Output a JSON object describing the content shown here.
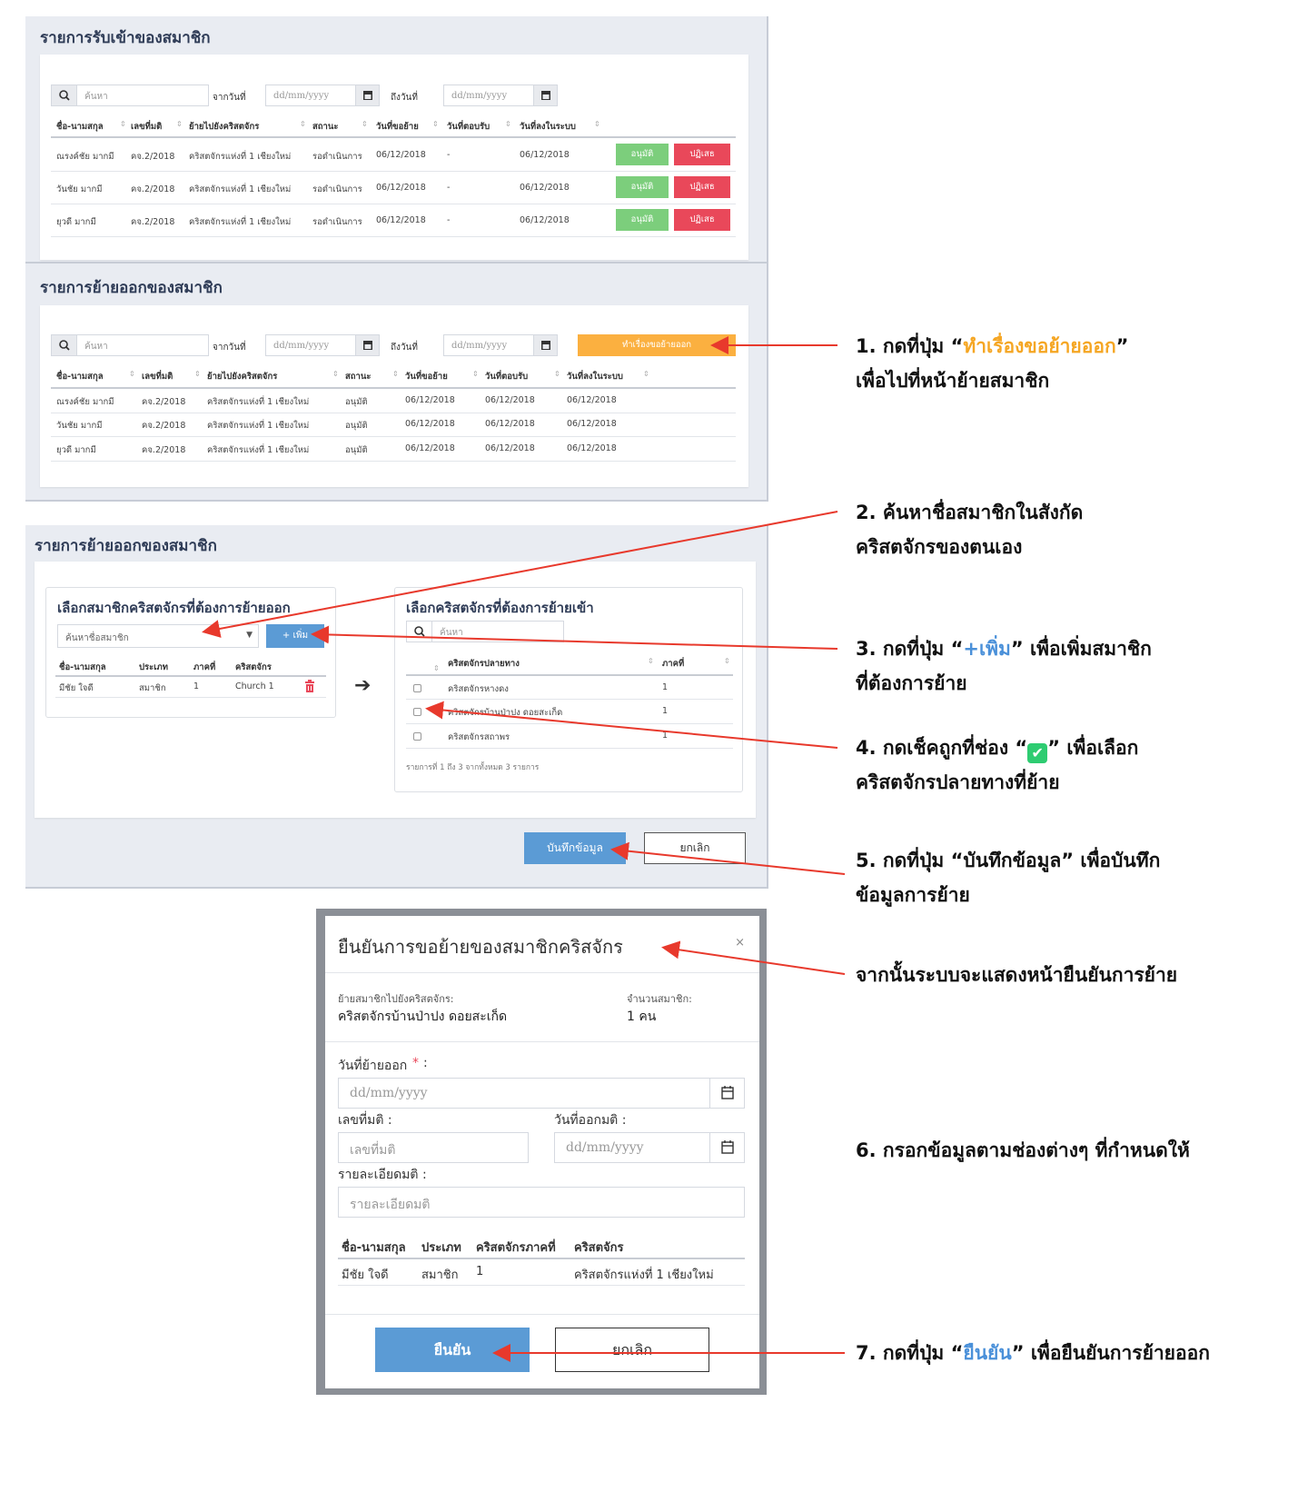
{
  "section1": {
    "title": "รายการรับเข้าของสมาชิก",
    "search_placeholder": "ค้นหา",
    "from_label": "จากวันที่",
    "to_label": "ถึงวันที่",
    "date_placeholder": "dd/mm/yyyy",
    "columns": [
      "ชื่อ-นามสกุล",
      "เลขที่มติ",
      "ย้ายไปยังคริสตจักร",
      "สถานะ",
      "วันที่ขอย้าย",
      "วันที่ตอบรับ",
      "วันที่ลงในระบบ"
    ],
    "rows": [
      {
        "name": "ณรงค์ชัย มากมี",
        "no": "คจ.2/2018",
        "church": "คริสตจักรแห่งที่ 1 เชียงใหม่",
        "status": "รอดำเนินการ",
        "req": "06/12/2018",
        "acc": "-",
        "sys": "06/12/2018"
      },
      {
        "name": "วันชัย มากมี",
        "no": "คจ.2/2018",
        "church": "คริสตจักรแห่งที่ 1 เชียงใหม่",
        "status": "รอดำเนินการ",
        "req": "06/12/2018",
        "acc": "-",
        "sys": "06/12/2018"
      },
      {
        "name": "ยุวดี มากมี",
        "no": "คจ.2/2018",
        "church": "คริสตจักรแห่งที่ 1 เชียงใหม่",
        "status": "รอดำเนินการ",
        "req": "06/12/2018",
        "acc": "-",
        "sys": "06/12/2018"
      }
    ],
    "approve_label": "อนุมัติ",
    "reject_label": "ปฏิเสธ"
  },
  "section2": {
    "title": "รายการย้ายออกของสมาชิก",
    "search_placeholder": "ค้นหา",
    "from_label": "จากวันที่",
    "to_label": "ถึงวันที่",
    "date_placeholder": "dd/mm/yyyy",
    "action_label": "ทำเรื่องขอย้ายออก",
    "columns": [
      "ชื่อ-นามสกุล",
      "เลขที่มติ",
      "ย้ายไปยังคริสตจักร",
      "สถานะ",
      "วันที่ขอย้าย",
      "วันที่ตอบรับ",
      "วันที่ลงในระบบ"
    ],
    "rows": [
      {
        "name": "ณรงค์ชัย มากมี",
        "no": "คจ.2/2018",
        "church": "คริสตจักรแห่งที่ 1 เชียงใหม่",
        "status": "อนุมัติ",
        "req": "06/12/2018",
        "acc": "06/12/2018",
        "sys": "06/12/2018"
      },
      {
        "name": "วันชัย มากมี",
        "no": "คจ.2/2018",
        "church": "คริสตจักรแห่งที่ 1 เชียงใหม่",
        "status": "อนุมัติ",
        "req": "06/12/2018",
        "acc": "06/12/2018",
        "sys": "06/12/2018"
      },
      {
        "name": "ยุวดี มากมี",
        "no": "คจ.2/2018",
        "church": "คริสตจักรแห่งที่ 1 เชียงใหม่",
        "status": "อนุมัติ",
        "req": "06/12/2018",
        "acc": "06/12/2018",
        "sys": "06/12/2018"
      }
    ]
  },
  "section3": {
    "title": "รายการย้ายออกของสมาชิก",
    "left": {
      "title": "เลือกสมาชิกคริสตจักรที่ต้องการย้ายออก",
      "select_placeholder": "ค้นหาชื่อสมาชิก",
      "add_label": "+ เพิ่ม",
      "columns": [
        "ชื่อ-นามสกุล",
        "ประเภท",
        "ภาคที่",
        "คริสตจักร"
      ],
      "row": {
        "name": "มีชัย ใจดี",
        "type": "สมาชิก",
        "region": "1",
        "church": "Church 1"
      }
    },
    "right": {
      "title": "เลือกคริสตจักรที่ต้องการย้ายเข้า",
      "search_placeholder": "ค้นหา",
      "columns": [
        "คริสตจักรปลายทาง",
        "ภาคที่"
      ],
      "rows": [
        {
          "church": "คริสตจักรหางดง",
          "region": "1"
        },
        {
          "church": "คริสตจักรบ้านป่าปง ดอยสะเก็ด",
          "region": "1"
        },
        {
          "church": "คริสตจักรสถาพร",
          "region": "1"
        }
      ],
      "footer": "รายการที่ 1 ถึง 3 จากทั้งหมด 3 รายการ"
    },
    "save_label": "บันทึกข้อมูล",
    "cancel_label": "ยกเลิก"
  },
  "modal": {
    "title": "ยืนยันการขอย้ายของสมาชิกคริสจักร",
    "close": "×",
    "dest_label": "ย้ายสมาชิกไปยังคริสตจักร:",
    "dest_value": "คริสตจักรบ้านป่าปง ดอยสะเก็ด",
    "count_label": "จำนวนสมาชิก:",
    "count_value": "1 คน",
    "move_date_label": "วันที่ย้ายออก",
    "required_mark": "*",
    "colon": ":",
    "date_placeholder": "dd/mm/yyyy",
    "resolution_no_label": "เลขที่มติ :",
    "resolution_no_placeholder": "เลขที่มติ",
    "resolution_date_label": "วันที่ออกมติ :",
    "resolution_detail_label": "รายละเอียดมติ :",
    "resolution_detail_placeholder": "รายละเอียดมติ",
    "columns": [
      "ชื่อ-นามสกุล",
      "ประเภท",
      "คริสตจักรภาคที่",
      "คริสตจักร"
    ],
    "row": {
      "name": "มีชัย ใจดี",
      "type": "สมาชิก",
      "region": "1",
      "church": "คริสตจักรแห่งที่ 1 เชียงใหม่"
    },
    "confirm_label": "ยืนยัน",
    "cancel_label": "ยกเลิก"
  },
  "annotations": {
    "a1_pre": "1. กดที่ปุ่ม “",
    "a1_hl": "ทำเรื่องขอย้ายออก",
    "a1_post": "”",
    "a1_line2": "เพื่อไปที่หน้าย้ายสมาชิก",
    "a2_line1": "2. ค้นหาชื่อสมาชิกในสังกัด",
    "a2_line2": "คริสตจักรของตนเอง",
    "a3_pre": "3. กดที่ปุ่ม “",
    "a3_hl": "+เพิ่ม",
    "a3_post": "” เพื่อเพิ่มสมาชิก",
    "a3_line2": "ที่ต้องการย้าย",
    "a4_pre": "4. กดเช็คถูกที่ช่อง “",
    "a4_post": "” เพื่อเลือก",
    "a4_line2": "คริสตจักรปลายทางที่ย้าย",
    "a5_line1": "5. กดที่ปุ่ม “บันทึกข้อมูล” เพื่อบันทึก",
    "a5_line2": "ข้อมูลการย้าย",
    "a_confirm": "จากนั้นระบบจะแสดงหน้ายืนยันการย้าย",
    "a6": "6. กรอกข้อมูลตามช่องต่างๆ ที่กำหนดให้",
    "a7_pre": "7. กดที่ปุ่ม “",
    "a7_hl": "ยืนยัน",
    "a7_post": "” เพื่อยืนยันการย้ายออก"
  },
  "colors": {
    "approve": "#7cce7c",
    "reject": "#e9485a",
    "request_button": "#fbb040",
    "primary": "#5b9bd5",
    "arrow": "#e8392c",
    "check": "#2ecc71"
  }
}
